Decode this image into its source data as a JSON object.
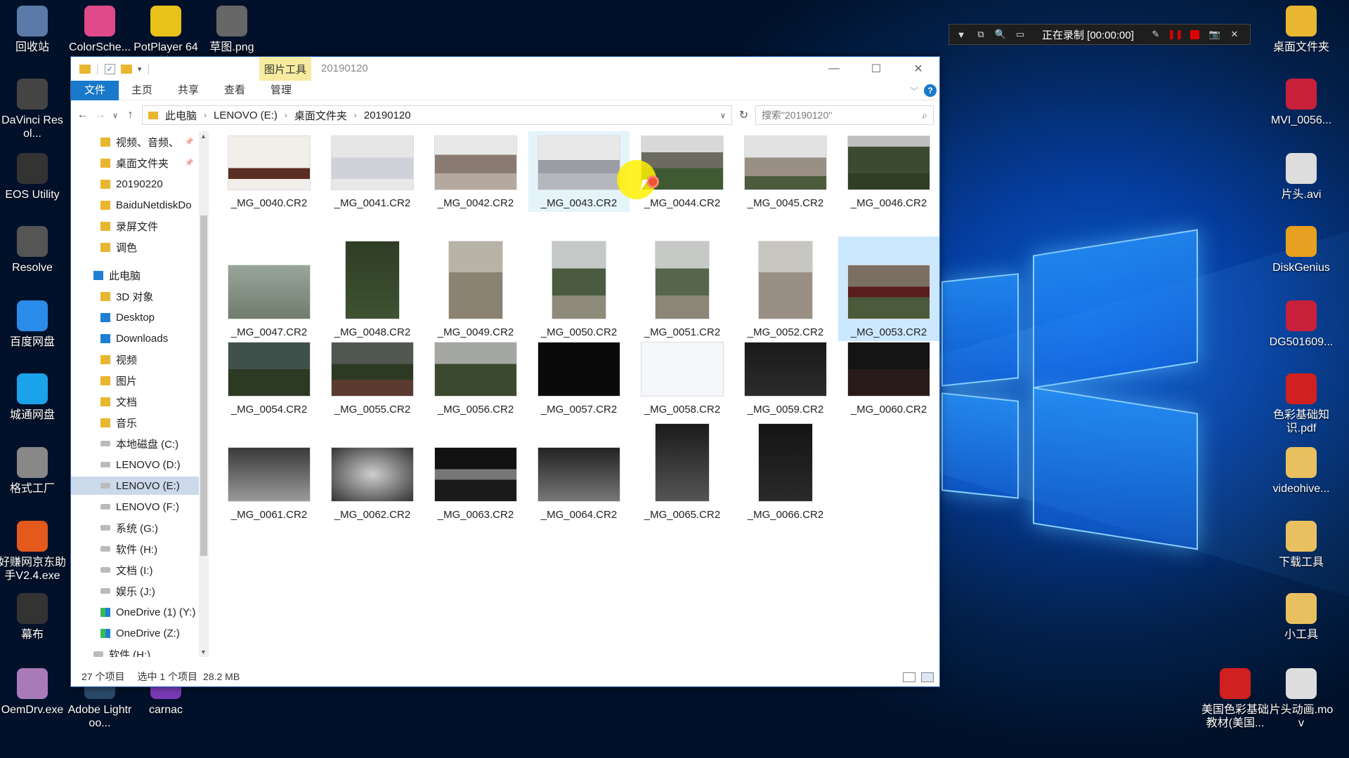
{
  "desktop_left": [
    {
      "label": "回收站",
      "icon": "recycle-bin-icon",
      "color": "#5a7aa8"
    },
    {
      "label": "DaVinci Resol...",
      "icon": "davinci-icon",
      "color": "#444"
    },
    {
      "label": "EOS Utility",
      "icon": "camera-icon",
      "color": "#333"
    },
    {
      "label": "Resolve",
      "icon": "resolve-icon",
      "color": "#555"
    },
    {
      "label": "百度网盘",
      "icon": "baidu-netdisk-icon",
      "color": "#2b8be8"
    },
    {
      "label": "城通网盘",
      "icon": "cloud-icon",
      "color": "#1aa3e8"
    },
    {
      "label": "格式工厂",
      "icon": "format-factory-icon",
      "color": "#888"
    },
    {
      "label": "好赚网京东助手V2.4.exe",
      "icon": "z-app-icon",
      "color": "#e55a1c"
    },
    {
      "label": "幕布",
      "icon": "mubu-icon",
      "color": "#333"
    },
    {
      "label": "OemDrv.exe",
      "icon": "gear-icon",
      "color": "#a87ab8"
    }
  ],
  "desktop_top": [
    {
      "label": "ColorSche... Studio",
      "icon": "color-wheel-icon",
      "color": "#e04a8a"
    },
    {
      "label": "PotPlayer 64 bit",
      "icon": "potplayer-icon",
      "color": "#e8c21a"
    },
    {
      "label": "草图.png",
      "icon": "image-file-icon",
      "color": "#666"
    }
  ],
  "desktop_bottom": [
    {
      "label": "Adobe Lightroo...",
      "icon": "lightroom-icon",
      "color": "#2b4a6a"
    },
    {
      "label": "carnac",
      "icon": "carnac-icon",
      "color": "#7a3ab8"
    }
  ],
  "desktop_right": [
    {
      "label": "桌面文件夹",
      "icon": "folder-icon",
      "color": "#e9b630"
    },
    {
      "label": "MVI_0056...",
      "icon": "z-app-icon",
      "color": "#c8203a"
    },
    {
      "label": "片头.avi",
      "icon": "video-file-icon",
      "color": "#ddd"
    },
    {
      "label": "DiskGenius",
      "icon": "diskgenius-icon",
      "color": "#e8a020"
    },
    {
      "label": "DG501609...",
      "icon": "z-app-icon",
      "color": "#c8203a"
    },
    {
      "label": "色彩基础知识.pdf",
      "icon": "pdf-icon",
      "color": "#d02020"
    },
    {
      "label": "videohive...",
      "icon": "folder-zip-icon",
      "color": "#e9c060"
    },
    {
      "label": "下载工具",
      "icon": "folder-icon",
      "color": "#e9c060"
    },
    {
      "label": "小工具",
      "icon": "folder-icon",
      "color": "#e9c060"
    }
  ],
  "desktop_right_bottom": [
    {
      "label": "美国色彩基础教材(美国...",
      "icon": "pdf-icon",
      "color": "#d02020"
    },
    {
      "label": "片头动画.mov",
      "icon": "video-file-icon",
      "color": "#ddd"
    }
  ],
  "recorder": {
    "status": "正在录制 [00:00:00]"
  },
  "window": {
    "context_tab": "图片工具",
    "title": "20190120",
    "ribbon_tabs": [
      "文件",
      "主页",
      "共享",
      "查看",
      "管理"
    ],
    "breadcrumb": [
      "此电脑",
      "LENOVO (E:)",
      "桌面文件夹",
      "20190120"
    ],
    "search_placeholder": "搜索\"20190120\"",
    "nav": [
      "视频、音频、",
      "桌面文件夹",
      "20190220",
      "BaiduNetdiskDo",
      "录屏文件",
      "调色",
      "此电脑",
      "3D 对象",
      "Desktop",
      "Downloads",
      "视频",
      "图片",
      "文档",
      "音乐",
      "本地磁盘 (C:)",
      "LENOVO (D:)",
      "LENOVO (E:)",
      "LENOVO (F:)",
      "系统 (G:)",
      "软件 (H:)",
      "文档 (I:)",
      "娱乐 (J:)",
      "OneDrive (1) (Y:)",
      "OneDrive (Z:)",
      "软件 (H:)"
    ],
    "files": [
      "_MG_0040.CR2",
      "_MG_0041.CR2",
      "_MG_0042.CR2",
      "_MG_0043.CR2",
      "_MG_0044.CR2",
      "_MG_0045.CR2",
      "_MG_0046.CR2",
      "_MG_0047.CR2",
      "_MG_0048.CR2",
      "_MG_0049.CR2",
      "_MG_0050.CR2",
      "_MG_0051.CR2",
      "_MG_0052.CR2",
      "_MG_0053.CR2",
      "_MG_0054.CR2",
      "_MG_0055.CR2",
      "_MG_0056.CR2",
      "_MG_0057.CR2",
      "_MG_0058.CR2",
      "_MG_0059.CR2",
      "_MG_0060.CR2",
      "_MG_0061.CR2",
      "_MG_0062.CR2",
      "_MG_0063.CR2",
      "_MG_0064.CR2",
      "_MG_0065.CR2",
      "_MG_0066.CR2"
    ],
    "status": {
      "count": "27 个项目",
      "selected": "选中 1 个项目",
      "size": "28.2 MB"
    }
  }
}
